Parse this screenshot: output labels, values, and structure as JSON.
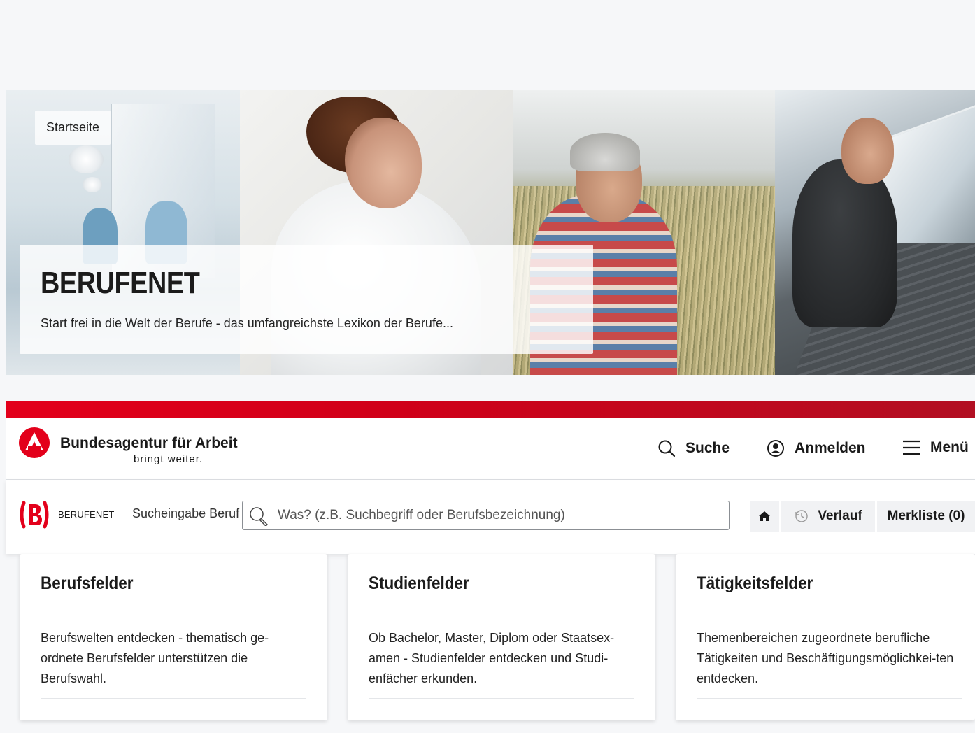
{
  "hero": {
    "breadcrumb": "Startseite",
    "title": "BERUFENET",
    "subtitle": "Start frei in die Welt der Berufe - das umfangreichste Lexikon der Berufe..."
  },
  "ba_header": {
    "org_name": "Bundesagentur für Arbeit",
    "claim": "bringt weiter.",
    "search_label": "Suche",
    "login_label": "Anmelden",
    "menu_label": "Menü",
    "brand_color": "#e3001b"
  },
  "berufenet_bar": {
    "logo_label": "BERUFENET",
    "search_label": "Sucheingabe Beruf",
    "search_placeholder": "Was? (z.B. Suchbegriff oder Berufsbezeichnung)",
    "search_value": "",
    "history_label": "Verlauf",
    "watchlist_label": "Merkliste (0)"
  },
  "cards": [
    {
      "title": "Berufsfelder",
      "text": "Berufswelten entdecken - thematisch ge-ordnete Berufsfelder unterstützen die Berufswahl."
    },
    {
      "title": "Studienfelder",
      "text": "Ob Bachelor, Master, Diplom oder Staatsex-amen - Studienfelder entdecken und Studi-enfächer erkunden."
    },
    {
      "title": "Tätigkeitsfelder",
      "text": "Themenbereichen zugeordnete berufliche Tätigkeiten und Beschäftigungsmöglichkei-ten entdecken."
    }
  ]
}
